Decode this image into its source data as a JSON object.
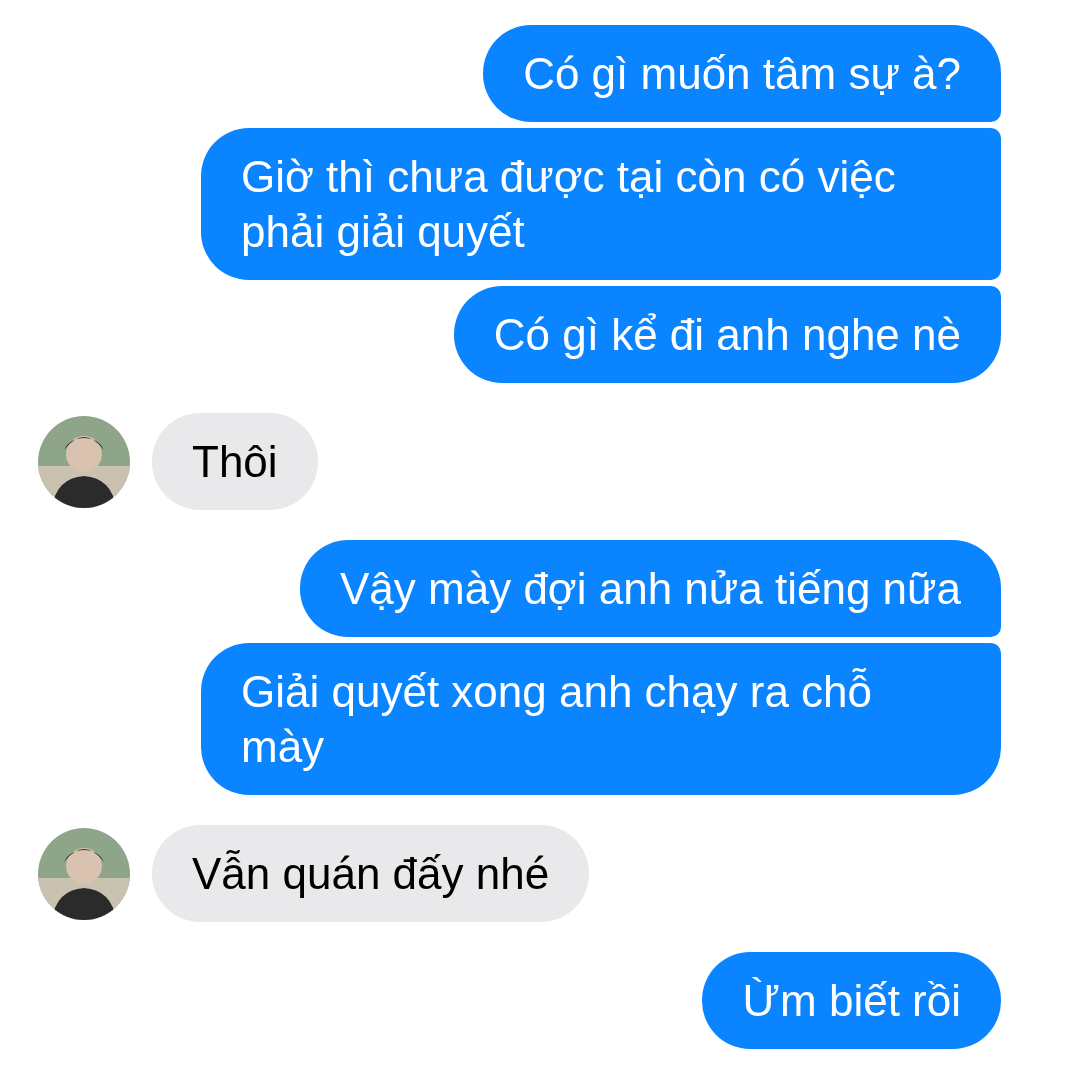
{
  "messages": [
    {
      "kind": "sent",
      "text": "Có gì muốn tâm sự à?"
    },
    {
      "kind": "sent",
      "text": "Giờ thì chưa được tại còn có việc phải giải quyết"
    },
    {
      "kind": "sent",
      "text": "Có gì kể đi anh nghe nè"
    },
    {
      "kind": "received",
      "text": "Thôi"
    },
    {
      "kind": "sent",
      "text": "Vậy mày đợi anh nửa tiếng nữa"
    },
    {
      "kind": "sent",
      "text": "Giải quyết xong anh chạy ra chỗ mày"
    },
    {
      "kind": "received",
      "text": "Vẫn quán đấy nhé"
    },
    {
      "kind": "sent",
      "text": "Ừm biết rồi"
    }
  ]
}
